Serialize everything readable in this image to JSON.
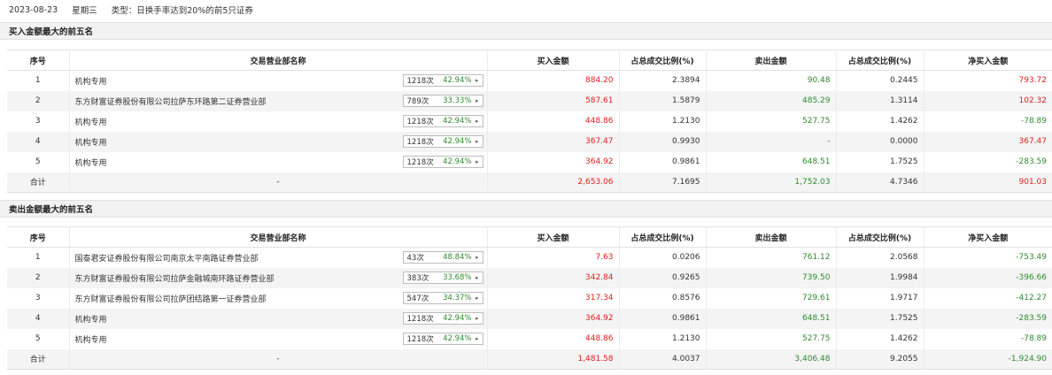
{
  "topbar": {
    "date": "2023-08-23",
    "weekday": "星期三",
    "type_text": "类型：日换手率达到20%的前5只证券"
  },
  "buy_section": {
    "title": "买入金额最大的前五名",
    "columns": [
      "序号",
      "交易营业部名称",
      "买入金额",
      "占总成交比例(%)",
      "卖出金额",
      "占总成交比例(%)",
      "净买入金额"
    ],
    "rows": [
      {
        "idx": "1",
        "name": "机构专用",
        "count": "1218次",
        "pct": "42.94%",
        "buy": "884.20",
        "buy_ratio": "2.3894",
        "sell": "90.48",
        "sell_ratio": "0.2445",
        "net": "793.72",
        "net_color": "red"
      },
      {
        "idx": "2",
        "name": "东方财富证券股份有限公司拉萨东环路第二证券营业部",
        "count": "789次",
        "pct": "33.33%",
        "buy": "587.61",
        "buy_ratio": "1.5879",
        "sell": "485.29",
        "sell_ratio": "1.3114",
        "net": "102.32",
        "net_color": "red"
      },
      {
        "idx": "3",
        "name": "机构专用",
        "count": "1218次",
        "pct": "42.94%",
        "buy": "448.86",
        "buy_ratio": "1.2130",
        "sell": "527.75",
        "sell_ratio": "1.4262",
        "net": "-78.89",
        "net_color": "green"
      },
      {
        "idx": "4",
        "name": "机构专用",
        "count": "1218次",
        "pct": "42.94%",
        "buy": "367.47",
        "buy_ratio": "0.9930",
        "sell": "-",
        "sell_ratio": "0.0000",
        "net": "367.47",
        "net_color": "red"
      },
      {
        "idx": "5",
        "name": "机构专用",
        "count": "1218次",
        "pct": "42.94%",
        "buy": "364.92",
        "buy_ratio": "0.9861",
        "sell": "648.51",
        "sell_ratio": "1.7525",
        "net": "-283.59",
        "net_color": "green"
      }
    ],
    "total": {
      "label": "合计",
      "name": "-",
      "buy": "2,653.06",
      "buy_ratio": "7.1695",
      "sell": "1,752.03",
      "sell_ratio": "4.7346",
      "net": "901.03",
      "net_color": "red"
    }
  },
  "sell_section": {
    "title": "卖出金额最大的前五名",
    "columns": [
      "序号",
      "交易营业部名称",
      "买入金额",
      "占总成交比例(%)",
      "卖出金额",
      "占总成交比例(%)",
      "净买入金额"
    ],
    "rows": [
      {
        "idx": "1",
        "name": "国泰君安证券股份有限公司南京太平南路证券营业部",
        "count": "43次",
        "pct": "48.84%",
        "buy": "7.63",
        "buy_ratio": "0.0206",
        "sell": "761.12",
        "sell_ratio": "2.0568",
        "net": "-753.49",
        "net_color": "green"
      },
      {
        "idx": "2",
        "name": "东方财富证券股份有限公司拉萨金融城南环路证券营业部",
        "count": "383次",
        "pct": "33.68%",
        "buy": "342.84",
        "buy_ratio": "0.9265",
        "sell": "739.50",
        "sell_ratio": "1.9984",
        "net": "-396.66",
        "net_color": "green"
      },
      {
        "idx": "3",
        "name": "东方财富证券股份有限公司拉萨团结路第一证券营业部",
        "count": "547次",
        "pct": "34.37%",
        "buy": "317.34",
        "buy_ratio": "0.8576",
        "sell": "729.61",
        "sell_ratio": "1.9717",
        "net": "-412.27",
        "net_color": "green"
      },
      {
        "idx": "4",
        "name": "机构专用",
        "count": "1218次",
        "pct": "42.94%",
        "buy": "364.92",
        "buy_ratio": "0.9861",
        "sell": "648.51",
        "sell_ratio": "1.7525",
        "net": "-283.59",
        "net_color": "green"
      },
      {
        "idx": "5",
        "name": "机构专用",
        "count": "1218次",
        "pct": "42.94%",
        "buy": "448.86",
        "buy_ratio": "1.2130",
        "sell": "527.75",
        "sell_ratio": "1.4262",
        "net": "-78.89",
        "net_color": "green"
      }
    ],
    "total": {
      "label": "合计",
      "name": "-",
      "buy": "1,481.58",
      "buy_ratio": "4.0037",
      "sell": "3,406.48",
      "sell_ratio": "9.2055",
      "net": "-1,924.90",
      "net_color": "green"
    }
  },
  "icons": {
    "row_arrow": "chevron-right-icon"
  },
  "colors": {
    "up": "#e0201b",
    "down": "#2e8b2e",
    "header_bg": "#f2f2f2",
    "stripe_bg": "#f4f4f4"
  }
}
